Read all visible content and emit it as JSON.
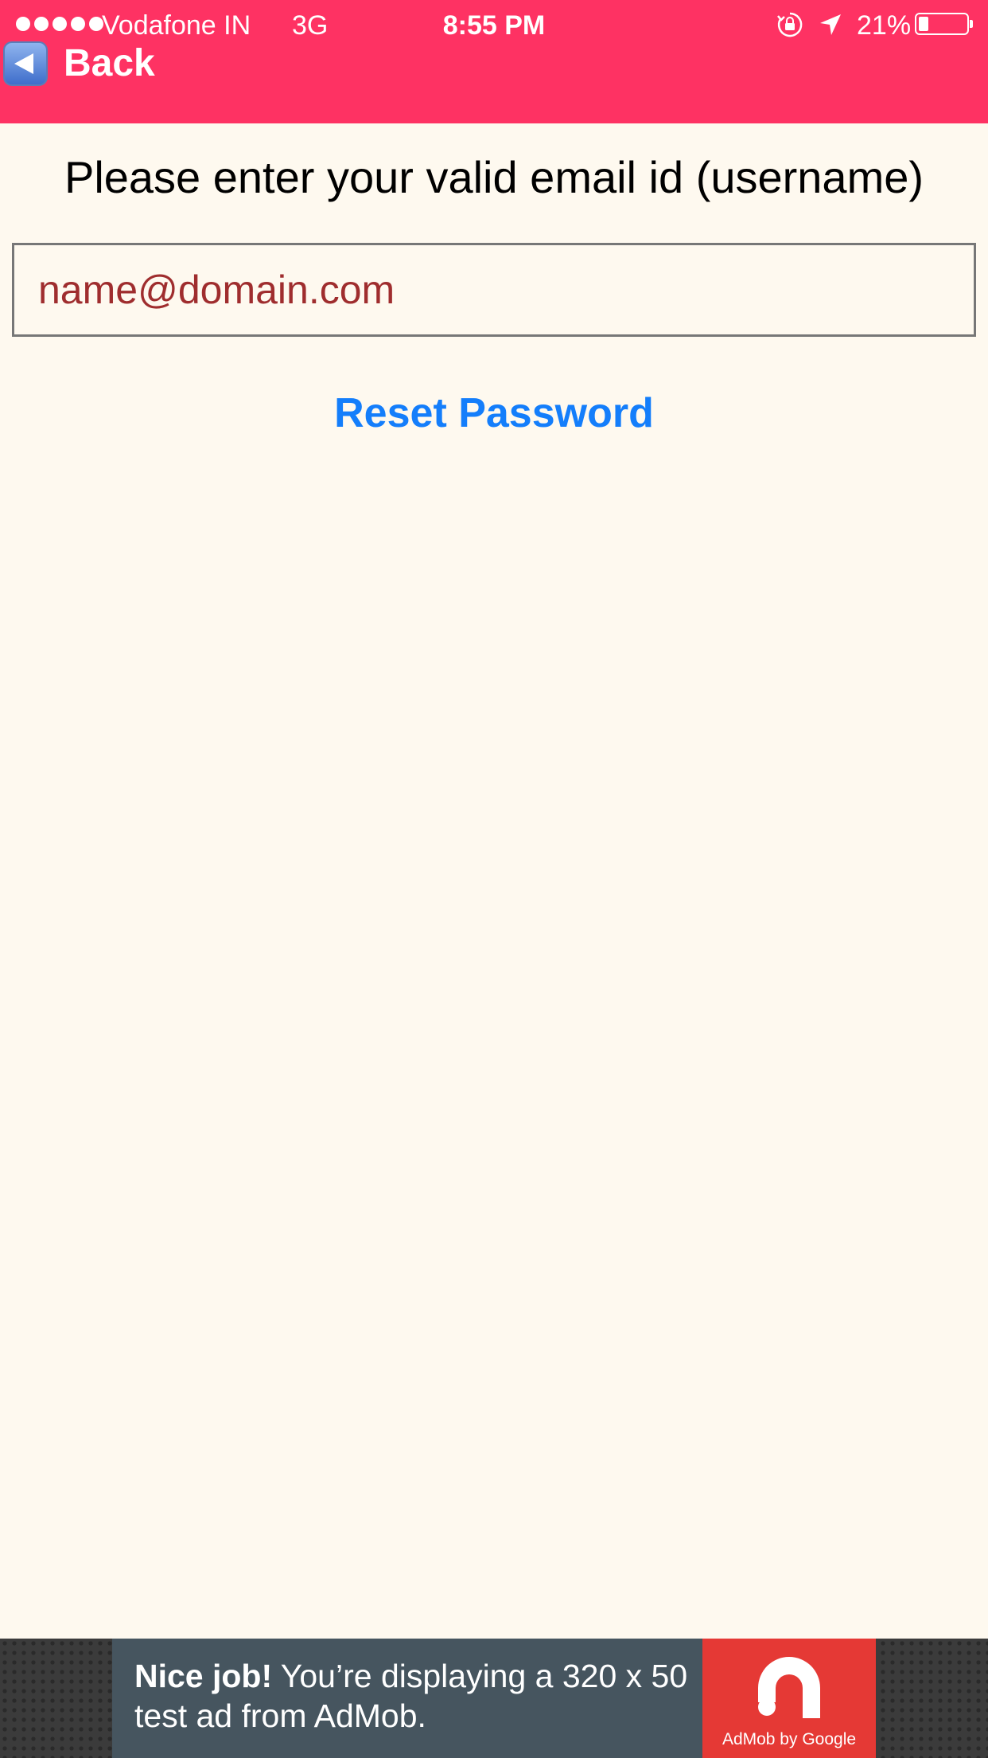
{
  "status_bar": {
    "carrier": "Vodafone IN",
    "network": "3G",
    "time": "8:55 PM",
    "battery_percent": "21%",
    "battery_level": 0.21,
    "signal_bars": 5,
    "icons": [
      "rotation-lock-icon",
      "location-arrow-icon",
      "battery-icon"
    ]
  },
  "nav": {
    "back_label": "Back",
    "back_icon": "back-arrow-icon",
    "header_color": "#fe3263"
  },
  "form": {
    "instruction": "Please enter your valid email id (username)",
    "email_placeholder": "name@domain.com",
    "email_value": "",
    "reset_label": "Reset Password",
    "link_color": "#147efb",
    "placeholder_color": "#9f2d2e"
  },
  "ad": {
    "headline": "Nice job!",
    "body": "You’re displaying a 320 x 50 test ad from AdMob.",
    "brand": "AdMob by Google",
    "logo_icon": "admob-logo-icon"
  }
}
